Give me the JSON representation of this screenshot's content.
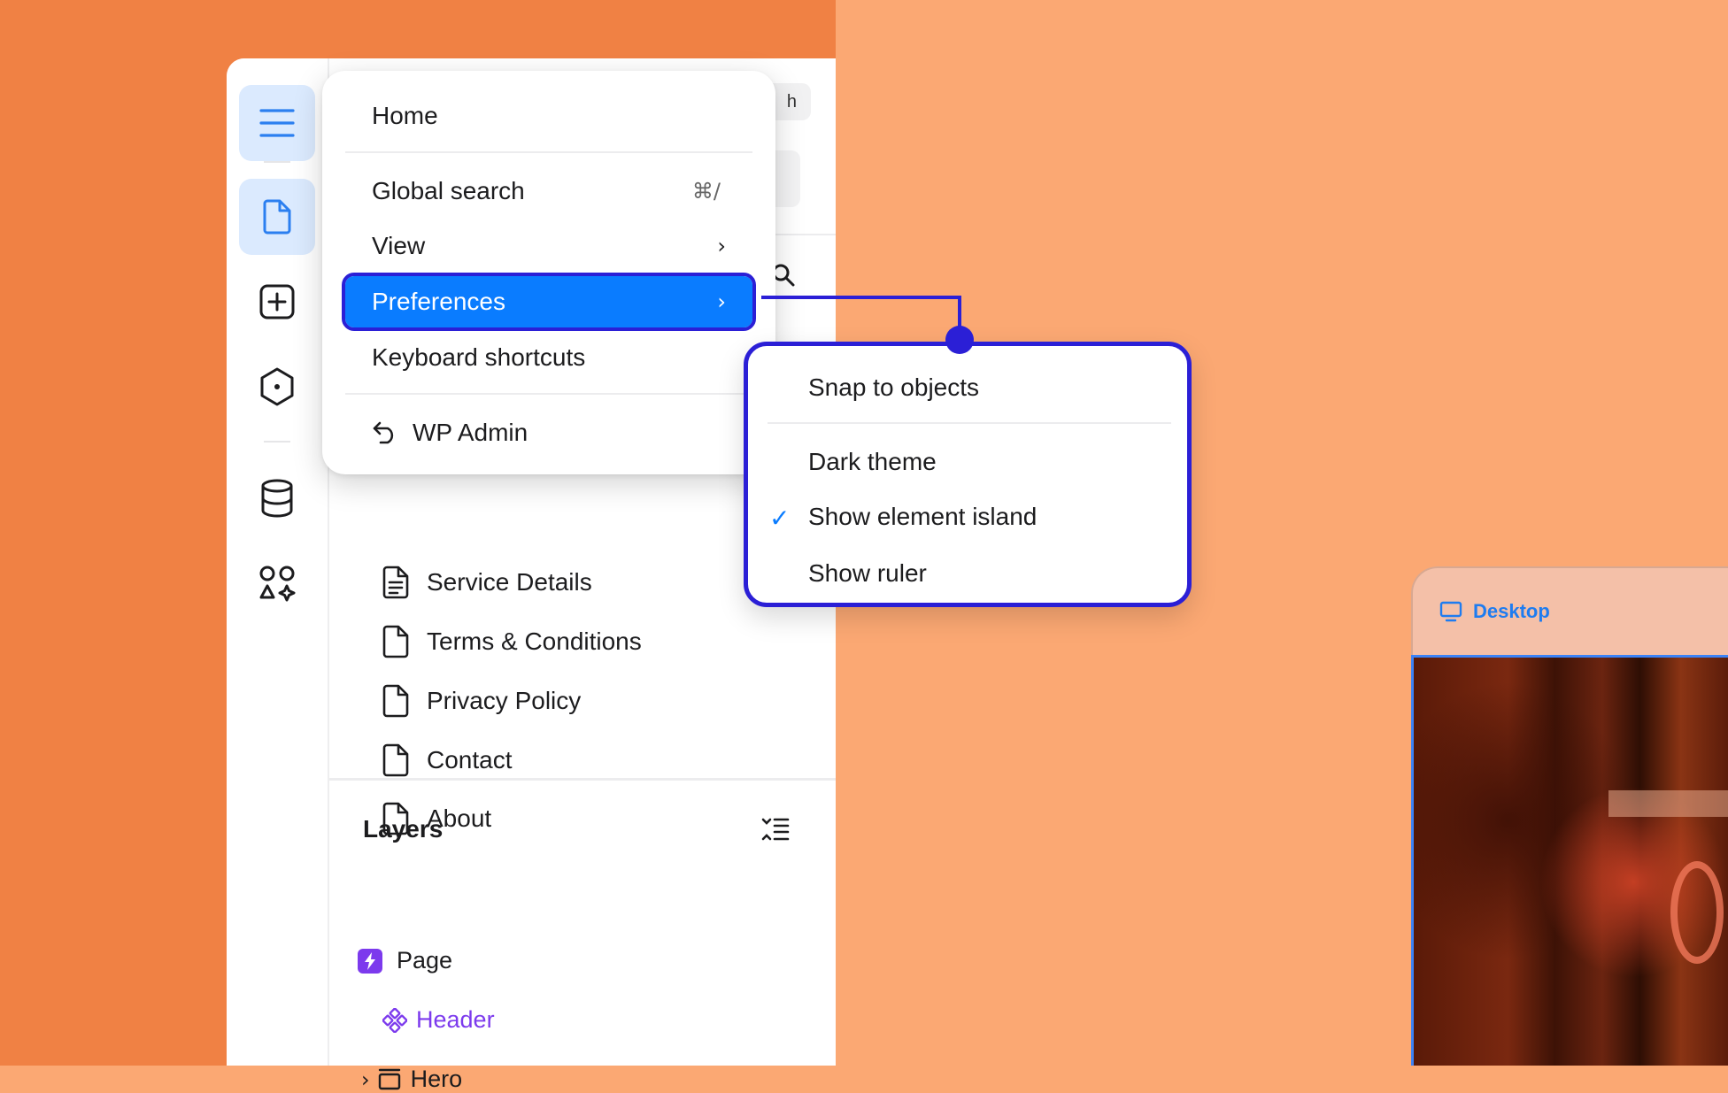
{
  "menu": {
    "items": [
      {
        "label": "Home"
      },
      {
        "label": "Global search",
        "shortcut": "⌘/"
      },
      {
        "label": "View",
        "chevron": "›"
      },
      {
        "label": "Preferences",
        "chevron": "›"
      },
      {
        "label": "Keyboard shortcuts"
      },
      {
        "label": "WP Admin"
      }
    ]
  },
  "submenu": {
    "items": [
      {
        "label": "Snap to objects"
      },
      {
        "label": "Dark theme"
      },
      {
        "label": "Show element island",
        "checkmark": "✓"
      },
      {
        "label": "Show ruler"
      }
    ]
  },
  "panel": {
    "ghost_button_text": "h",
    "pages": [
      {
        "label": "Service Details"
      },
      {
        "label": "Terms & Conditions"
      },
      {
        "label": "Privacy Policy"
      },
      {
        "label": "Contact"
      },
      {
        "label": "About"
      }
    ]
  },
  "layers": {
    "title": "Layers",
    "items": [
      {
        "label": "Page"
      },
      {
        "label": "Header"
      },
      {
        "label": "Hero",
        "chevron": "›"
      }
    ]
  },
  "device": {
    "label": "Desktop"
  },
  "colors": {
    "accent_blue": "#0a7cff",
    "highlight_outline": "#2b1fd6",
    "layer_purple": "#7c3aed",
    "bg_orange": "#f08144",
    "bg_peach": "#fba873"
  }
}
